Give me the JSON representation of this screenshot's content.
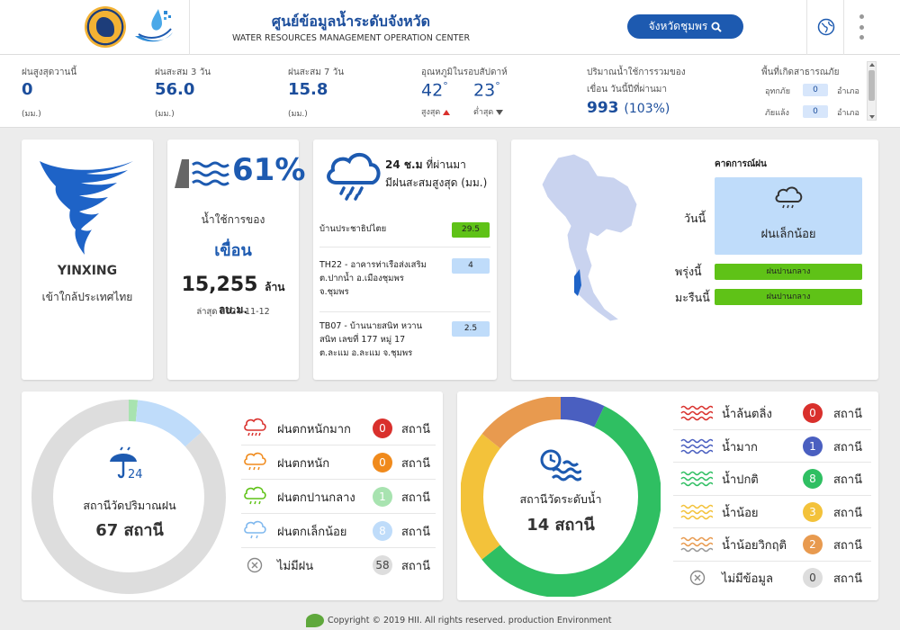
{
  "header": {
    "title": "ศูนย์ข้อมูลน้ำระดับจังหวัด",
    "subtitle": "WATER RESOURCES MANAGEMENT OPERATION CENTER",
    "province_button": "จังหวัดชุมพร"
  },
  "stats": {
    "rain_max_yesterday": {
      "label": "ฝนสูงสุดวานนี้",
      "value": "0",
      "unit": "(มม.)"
    },
    "rain_3day": {
      "label": "ฝนสะสม 3 วัน",
      "value": "56.0",
      "unit": "(มม.)"
    },
    "rain_7day": {
      "label": "ฝนสะสม 7 วัน",
      "value": "15.8",
      "unit": "(มม.)"
    },
    "temperature": {
      "label": "อุณหภูมิในรอบสัปดาห์",
      "max": "42",
      "min": "23",
      "deg": "°",
      "max_label": "สูงสุด",
      "min_label": "ต่ำสุด"
    },
    "reservoir": {
      "label1": "ปริมาณน้ำใช้การรวมของ",
      "label2": "เขื่อน วันนี้ปีที่ผ่านมา",
      "value": "993",
      "pct": "(103%)"
    },
    "disaster": {
      "label": "พื้นที่เกิดสาธารณภัย",
      "flood_label": "อุทกภัย",
      "flood_value": "0",
      "drought_label": "ภัยแล้ง",
      "drought_value": "0",
      "unit": "อำเภอ"
    }
  },
  "storm": {
    "name": "YINXING",
    "status": "เข้าใกล้ประเทศไทย"
  },
  "dam": {
    "percent": "61%",
    "label1": "น้ำใช้การของ",
    "label2": "เขื่อน",
    "volume": "15,255",
    "volume_unit": "ล้าน ลบ.ม.",
    "date": "ล่าสุด 2024-11-12"
  },
  "rain24": {
    "head1": "24 ช.ม",
    "head1b": " ที่ผ่านมา",
    "head2": "มีฝนสะสมสูงสุด (มม.)",
    "stations": [
      {
        "name": "บ้านประชาธิปไตย",
        "value": "29.5",
        "color": "#5fc217"
      },
      {
        "name": "TH22 - อาคารท่าเรือส่งเสริม ต.ปากน้ำ อ.เมืองชุมพร จ.ชุมพร",
        "value": "4",
        "color": "#bfdcfa"
      },
      {
        "name": "TB07 - บ้านนายสนิท หวาน สนิท เลขที่ 177 หมู่ 17 ต.ละแม อ.ละแม จ.ชุมพร",
        "value": "2.5",
        "color": "#bfdcfa"
      }
    ]
  },
  "forecast": {
    "title": "คาดการณ์ฝน",
    "today_label": "วันนี้",
    "today_value": "ฝนเล็กน้อย",
    "tomorrow_label": "พรุ่งนี้",
    "tomorrow_value": "ฝนปานกลาง",
    "dayafter_label": "มะรืนนี้",
    "dayafter_value": "ฝนปานกลาง"
  },
  "rain_gauge": {
    "center_label": "สถานีวัดปริมาณฝน",
    "center_count": "67 สถานี",
    "unit": "สถานี",
    "items": [
      {
        "label": "ฝนตกหนักมาก",
        "count": 0,
        "color": "#d9302c",
        "icon": "heavy-rain-icon"
      },
      {
        "label": "ฝนตกหนัก",
        "count": 0,
        "color": "#f08a1c",
        "icon": "heavy-rain-icon"
      },
      {
        "label": "ฝนตกปานกลาง",
        "count": 1,
        "color": "#a8e3b0",
        "icon": "moderate-rain-icon"
      },
      {
        "label": "ฝนตกเล็กน้อย",
        "count": 8,
        "color": "#bfdcfa",
        "icon": "light-rain-icon"
      },
      {
        "label": "ไม่มีฝน",
        "count": 58,
        "color": "#dddddd",
        "icon": "no-rain-icon"
      }
    ]
  },
  "water_level": {
    "center_label": "สถานีวัดระดับน้ำ",
    "center_count": "14 สถานี",
    "unit": "สถานี",
    "items": [
      {
        "label": "น้ำล้นตลิ่ง",
        "count": 0,
        "color": "#d9302c"
      },
      {
        "label": "น้ำมาก",
        "count": 1,
        "color": "#4a5fc0"
      },
      {
        "label": "น้ำปกติ",
        "count": 8,
        "color": "#2fbf62"
      },
      {
        "label": "น้ำน้อย",
        "count": 3,
        "color": "#f3c23a"
      },
      {
        "label": "น้ำน้อยวิกฤติ",
        "count": 2,
        "color": "#e89a4f"
      },
      {
        "label": "ไม่มีข้อมูล",
        "count": 0,
        "color": "#dddddd"
      }
    ]
  },
  "footer": {
    "text": "Copyright © 2019 HII. All rights reserved. production Environment"
  }
}
